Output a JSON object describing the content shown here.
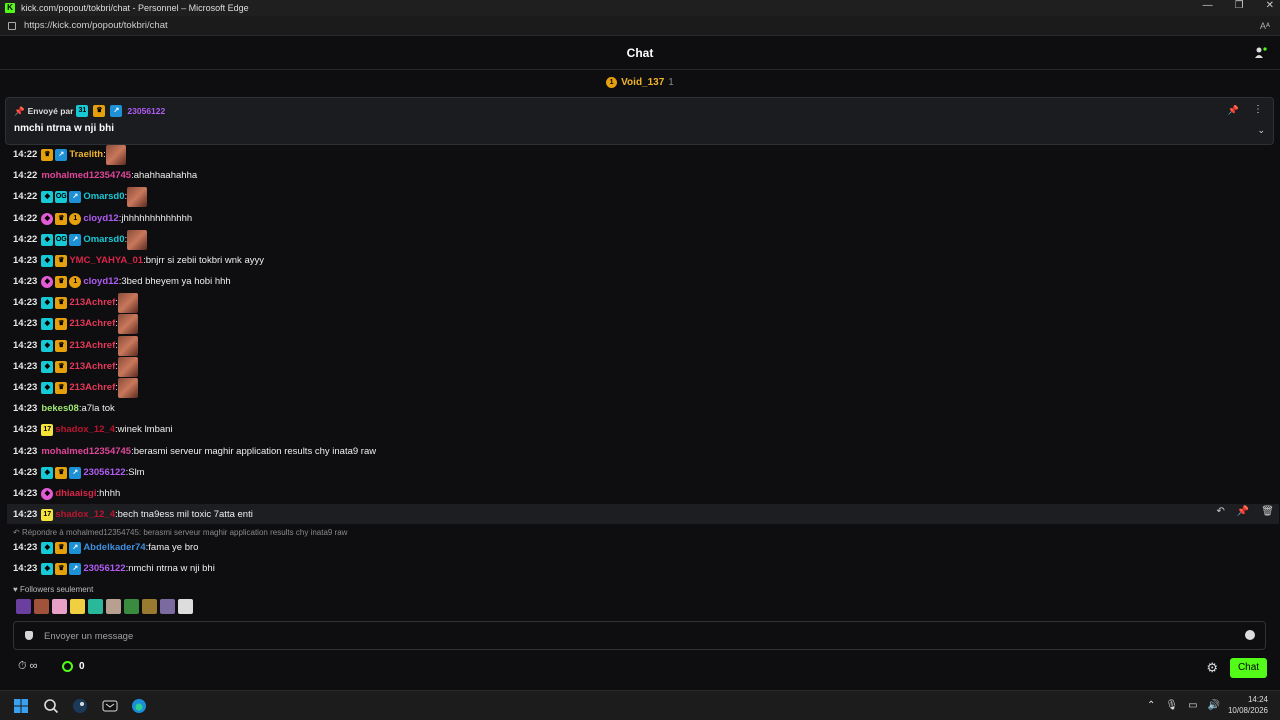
{
  "window": {
    "title": "kick.com/popout/tokbri/chat - Personnel – Microsoft Edge",
    "url": "https://kick.com/popout/tokbri/chat",
    "read_aloud": "Aᴬ"
  },
  "header": {
    "title": "Chat"
  },
  "top_gifter": {
    "name": "Void_137",
    "count": "1"
  },
  "pinned": {
    "sent_by_label": "Envoyé par",
    "sender": "23056122",
    "message": "nmchi ntrna w nji bhi"
  },
  "messages": [
    {
      "time": "14:22",
      "user": "Traelith",
      "color": "#f0b429",
      "text": ""
    },
    {
      "time": "14:22",
      "user": "mohalmed12354745",
      "color": "#e0469a",
      "text": "ahahhaahahha"
    },
    {
      "time": "14:22",
      "user": "Omarsd0",
      "color": "#16c9d4",
      "text": ""
    },
    {
      "time": "14:22",
      "user": "cloyd12",
      "color": "#b05cf5",
      "text": "jhhhhhhhhhhhhh"
    },
    {
      "time": "14:22",
      "user": "Omarsd0",
      "color": "#16c9d4",
      "text": ""
    },
    {
      "time": "14:23",
      "user": "YMC_YAHYA_01",
      "color": "#d9264a",
      "text": "bnjrr si zebii tokbri wnk ayyy"
    },
    {
      "time": "14:23",
      "user": "cloyd12",
      "color": "#b05cf5",
      "text": "3bed bheyem ya hobi hhh"
    },
    {
      "time": "14:23",
      "user": "213Achref",
      "color": "#e5395a",
      "text": ""
    },
    {
      "time": "14:23",
      "user": "213Achref",
      "color": "#e5395a",
      "text": ""
    },
    {
      "time": "14:23",
      "user": "213Achref",
      "color": "#e5395a",
      "text": ""
    },
    {
      "time": "14:23",
      "user": "213Achref",
      "color": "#e5395a",
      "text": ""
    },
    {
      "time": "14:23",
      "user": "213Achref",
      "color": "#e5395a",
      "text": ""
    },
    {
      "time": "14:23",
      "user": "bekes08",
      "color": "#9fe870",
      "text": "a7la tok"
    },
    {
      "time": "14:23",
      "user": "shadox_12_4",
      "color": "#b8162f",
      "text": "winek lmbani"
    },
    {
      "time": "14:23",
      "user": "mohalmed12354745",
      "color": "#e0469a",
      "text": "berasmi serveur maghir application results chy inata9 raw"
    },
    {
      "time": "14:23",
      "user": "23056122",
      "color": "#b05cf5",
      "text": "Slm"
    },
    {
      "time": "14:23",
      "user": "dhiaaisgi",
      "color": "#d9264a",
      "text": "hhhh"
    },
    {
      "time": "14:23",
      "user": "shadox_12_4",
      "color": "#b8162f",
      "text": "bech tna9ess mil toxic 7atta enti"
    },
    {
      "time": "14:23",
      "user": "Abdelkader74",
      "color": "#3f8fe0",
      "text": "fama ye bro"
    },
    {
      "time": "14:23",
      "user": "23056122",
      "color": "#b05cf5",
      "text": "nmchi ntrna w nji bhi"
    }
  ],
  "reply_ref": "Répondre à mohalmed12354745: berasmi serveur maghir application results chy inata9 raw",
  "followers_only": "Followers seulement",
  "input": {
    "placeholder": "Envoyer un message"
  },
  "footer": {
    "mode": "∞",
    "points": "0",
    "chat_button": "Chat"
  },
  "clock": {
    "time": "14:24",
    "date": "10/08/2026"
  }
}
